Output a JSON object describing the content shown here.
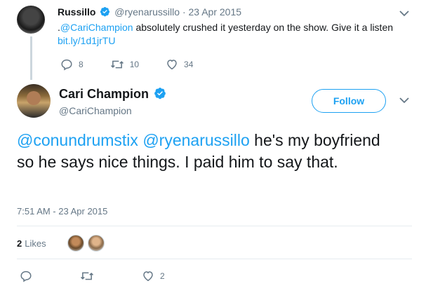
{
  "quoted_tweet": {
    "display_name": "Russillo",
    "handle": "@ryenarussillo",
    "separator": "·",
    "date": "23 Apr 2015",
    "text_prefix": ".",
    "mention": "@CariChampion",
    "text_body": " absolutely crushed it yesterday on the show. Give it a listen",
    "link": "bit.ly/1d1jrTU",
    "reply_count": "8",
    "retweet_count": "10",
    "like_count": "34"
  },
  "main_tweet": {
    "display_name": "Cari Champion",
    "handle": "@CariChampion",
    "follow_label": "Follow",
    "mention1": "@conundrumstix",
    "mention2": "@ryenarussillo",
    "text_body": " he's my boyfriend so he says nice things. I paid him to say that.",
    "timestamp": "7:51 AM - 23 Apr 2015",
    "likes_count": "2",
    "likes_label": "Likes",
    "action_like_count": "2"
  },
  "colors": {
    "accent": "#1da1f2",
    "muted": "#657786",
    "text": "#14171a",
    "divider": "#e6ecf0"
  },
  "icons": [
    "verified-badge-icon",
    "chevron-down-icon",
    "reply-icon",
    "retweet-icon",
    "heart-icon"
  ]
}
